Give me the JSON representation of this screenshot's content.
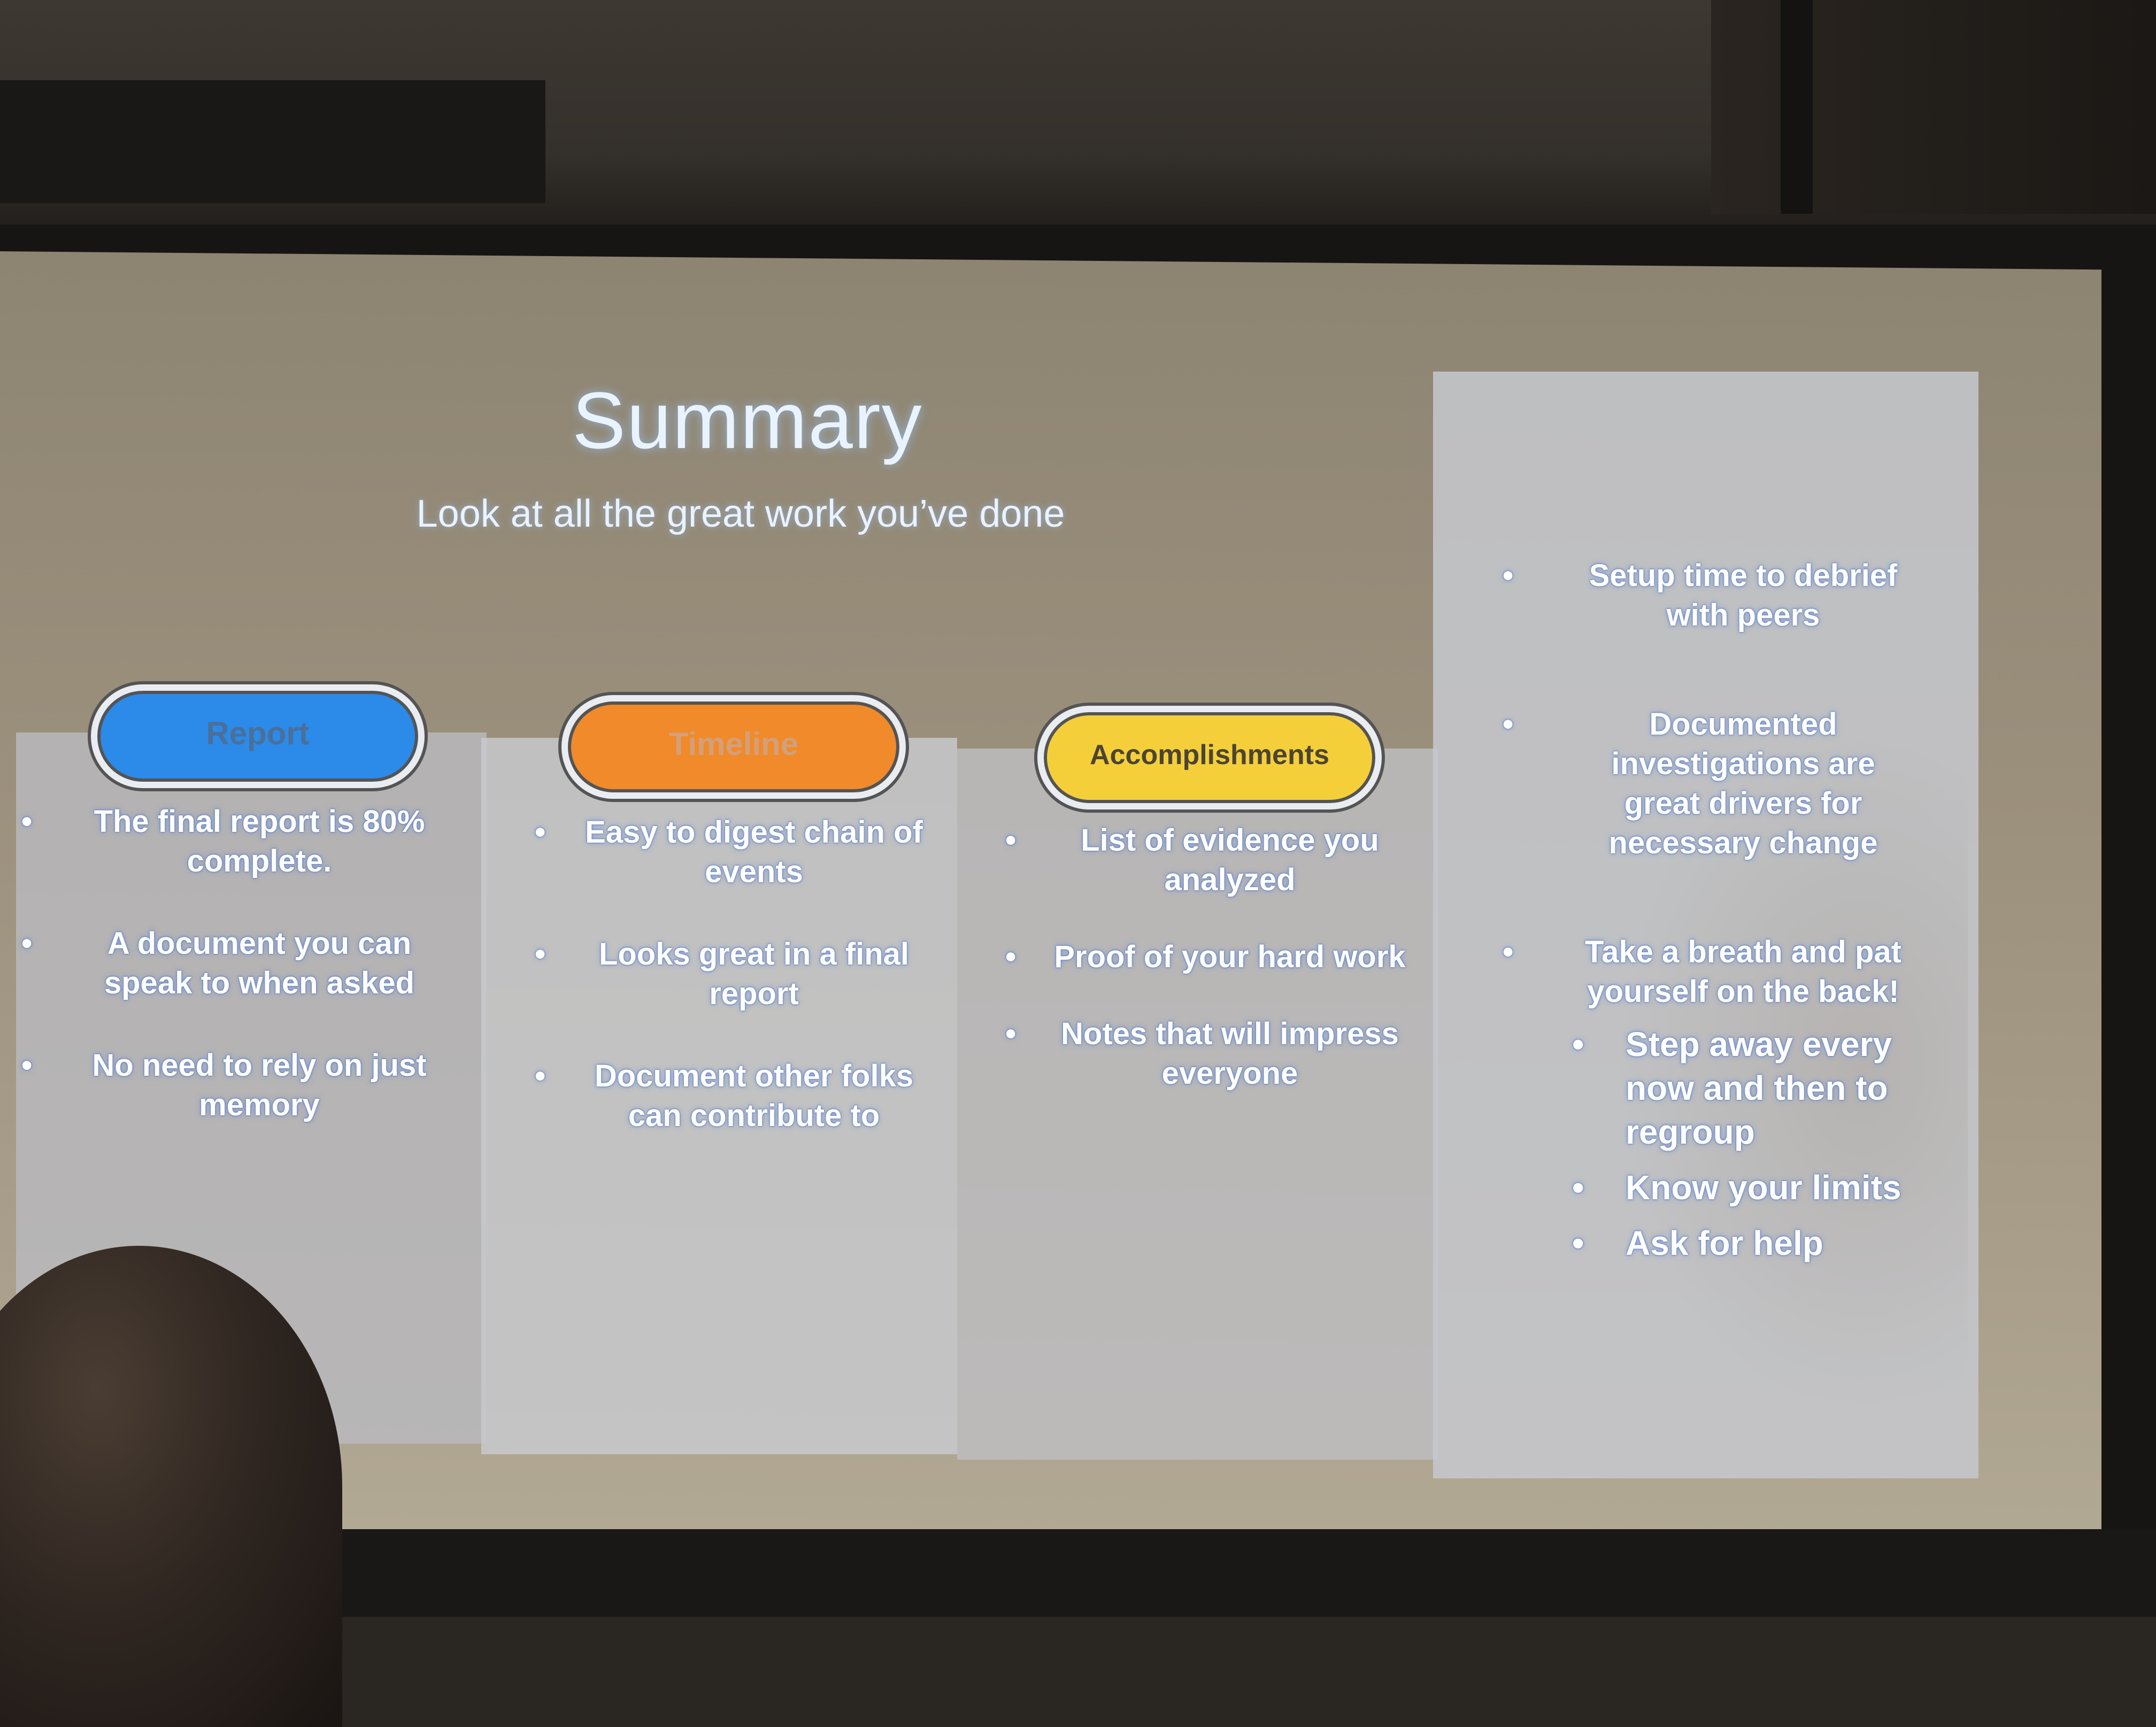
{
  "slide": {
    "title": "Summary",
    "subtitle": "Look at all the great work you’ve done",
    "columns": [
      {
        "heading": "Report",
        "color": "#2c8ae8",
        "bullets": [
          "The final report is 80% complete.",
          "A document you can speak to when asked",
          "No need to rely on just memory"
        ]
      },
      {
        "heading": "Timeline",
        "color": "#f08a2a",
        "bullets": [
          "Easy to digest chain of events",
          "Looks great in a final report",
          "Document other folks can contribute to"
        ]
      },
      {
        "heading": "Accomplishments",
        "color": "#f5cf3a",
        "bullets": [
          "List of evidence you analyzed",
          "Proof of your hard work",
          "Notes that will impress everyone"
        ]
      }
    ],
    "side_panel": {
      "bullets": [
        "Setup time to debrief with peers",
        "Documented investigations are great drivers for necessary change",
        "Take a breath and pat yourself on the back!"
      ],
      "sub_bullets": [
        "Step away every now and then to regroup",
        "Know your limits",
        "Ask for help"
      ]
    }
  }
}
